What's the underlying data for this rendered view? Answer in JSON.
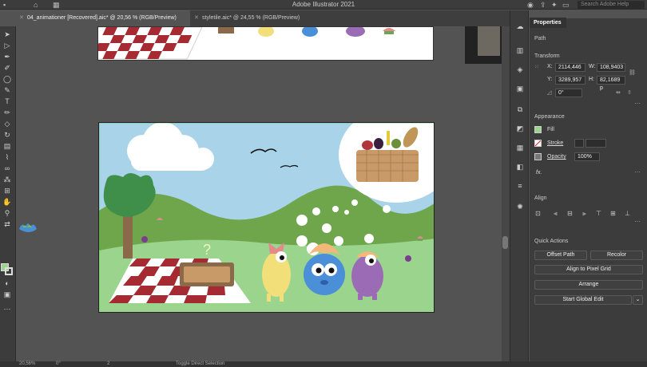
{
  "app": {
    "title": "Adobe Illustrator 2021",
    "search_placeholder": "Search Adobe Help"
  },
  "tabs": [
    {
      "label": "04_animationer [Recovered].aic* @ 20,56 % (RGB/Preview)",
      "active": true
    },
    {
      "label": "styletile.aic* @ 24,55 % (RGB/Preview)",
      "active": false
    }
  ],
  "properties": {
    "tab_label": "Properties",
    "object_type": "Path",
    "transform": {
      "title": "Transform",
      "x_label": "X:",
      "x_value": "2114,446",
      "y_label": "Y:",
      "y_value": "3289,957",
      "w_label": "W:",
      "w_value": "108,9403",
      "h_label": "H:",
      "h_value": "82,1689 p",
      "angle_value": "0°"
    },
    "appearance": {
      "title": "Appearance",
      "fill_label": "Fill",
      "stroke_label": "Stroke",
      "opacity_label": "Opacity",
      "opacity_value": "100%",
      "fx_label": "fx."
    },
    "align": {
      "title": "Align"
    },
    "quick_actions": {
      "title": "Quick Actions",
      "offset_path": "Offset Path",
      "recolor": "Recolor",
      "align_pixel_grid": "Align to Pixel Grid",
      "arrange": "Arrange",
      "start_global_edit": "Start Global Edit"
    }
  },
  "status": {
    "zoom": "20,56%",
    "angle": "0°",
    "artboard": "2",
    "tool": "Toggle Direct Selection"
  },
  "colors": {
    "sky": "#a9d3e9",
    "grass": "#6fa64c",
    "light_grass": "#9bd48c",
    "checker_red": "#a52a31",
    "basket": "#b48a5a"
  }
}
